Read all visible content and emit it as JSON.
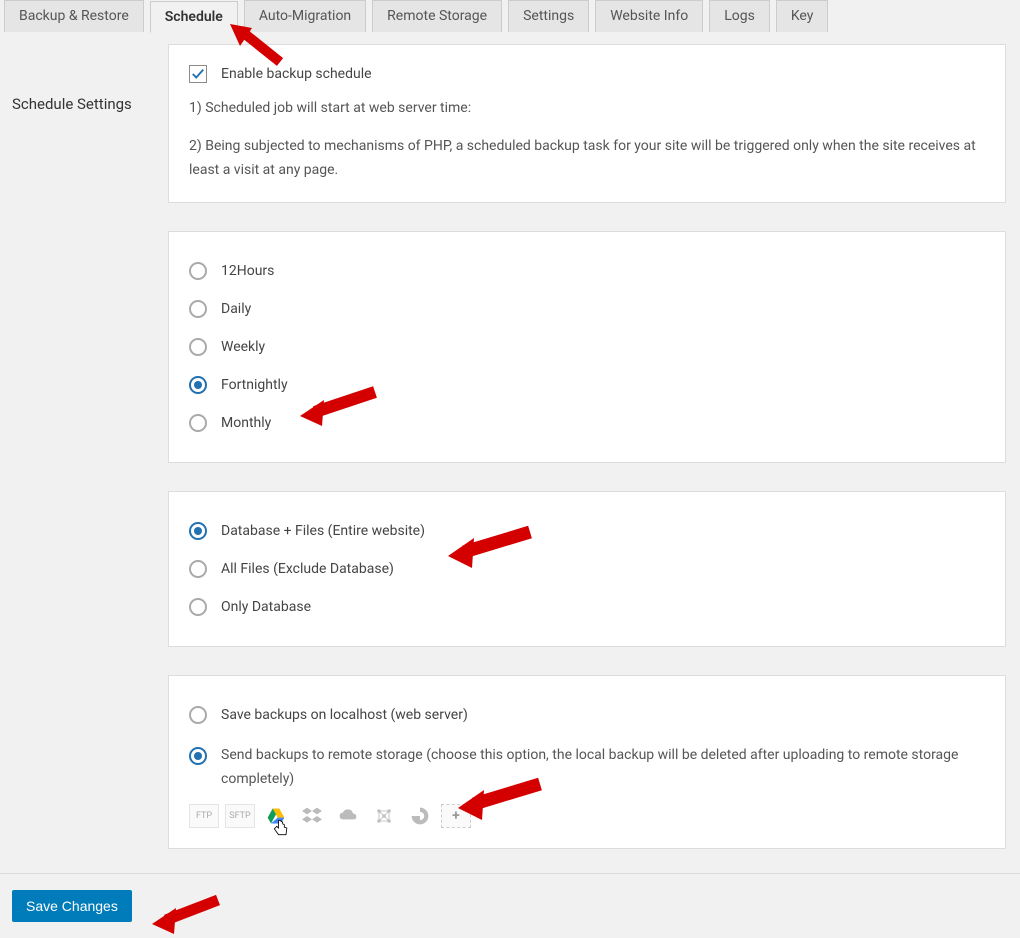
{
  "tabs": [
    {
      "label": "Backup & Restore",
      "active": false
    },
    {
      "label": "Schedule",
      "active": true
    },
    {
      "label": "Auto-Migration",
      "active": false
    },
    {
      "label": "Remote Storage",
      "active": false
    },
    {
      "label": "Settings",
      "active": false
    },
    {
      "label": "Website Info",
      "active": false
    },
    {
      "label": "Logs",
      "active": false
    },
    {
      "label": "Key",
      "active": false
    }
  ],
  "sidebar": {
    "title": "Schedule Settings"
  },
  "enable": {
    "label": "Enable backup schedule",
    "checked": true,
    "note1": "1) Scheduled job will start at web server time:",
    "note2": "2) Being subjected to mechanisms of PHP, a scheduled backup task for your site will be triggered only when the site receives at least a visit at any page."
  },
  "frequency": {
    "options": [
      {
        "label": "12Hours",
        "selected": false
      },
      {
        "label": "Daily",
        "selected": false
      },
      {
        "label": "Weekly",
        "selected": false
      },
      {
        "label": "Fortnightly",
        "selected": true
      },
      {
        "label": "Monthly",
        "selected": false
      }
    ]
  },
  "scope": {
    "options": [
      {
        "label": "Database + Files (Entire website)",
        "selected": true
      },
      {
        "label": "All Files (Exclude Database)",
        "selected": false
      },
      {
        "label": "Only Database",
        "selected": false
      }
    ]
  },
  "destination": {
    "local_label": "Save backups on localhost (web server)",
    "local_selected": false,
    "remote_label": "Send backups to remote storage (choose this option, the local backup will be deleted after uploading to remote storage completely)",
    "remote_selected": true,
    "icons": [
      "FTP",
      "SFTP",
      "google-drive",
      "dropbox",
      "onedrive",
      "amazon-s3",
      "digitalocean",
      "add"
    ]
  },
  "footer": {
    "save_label": "Save Changes"
  }
}
